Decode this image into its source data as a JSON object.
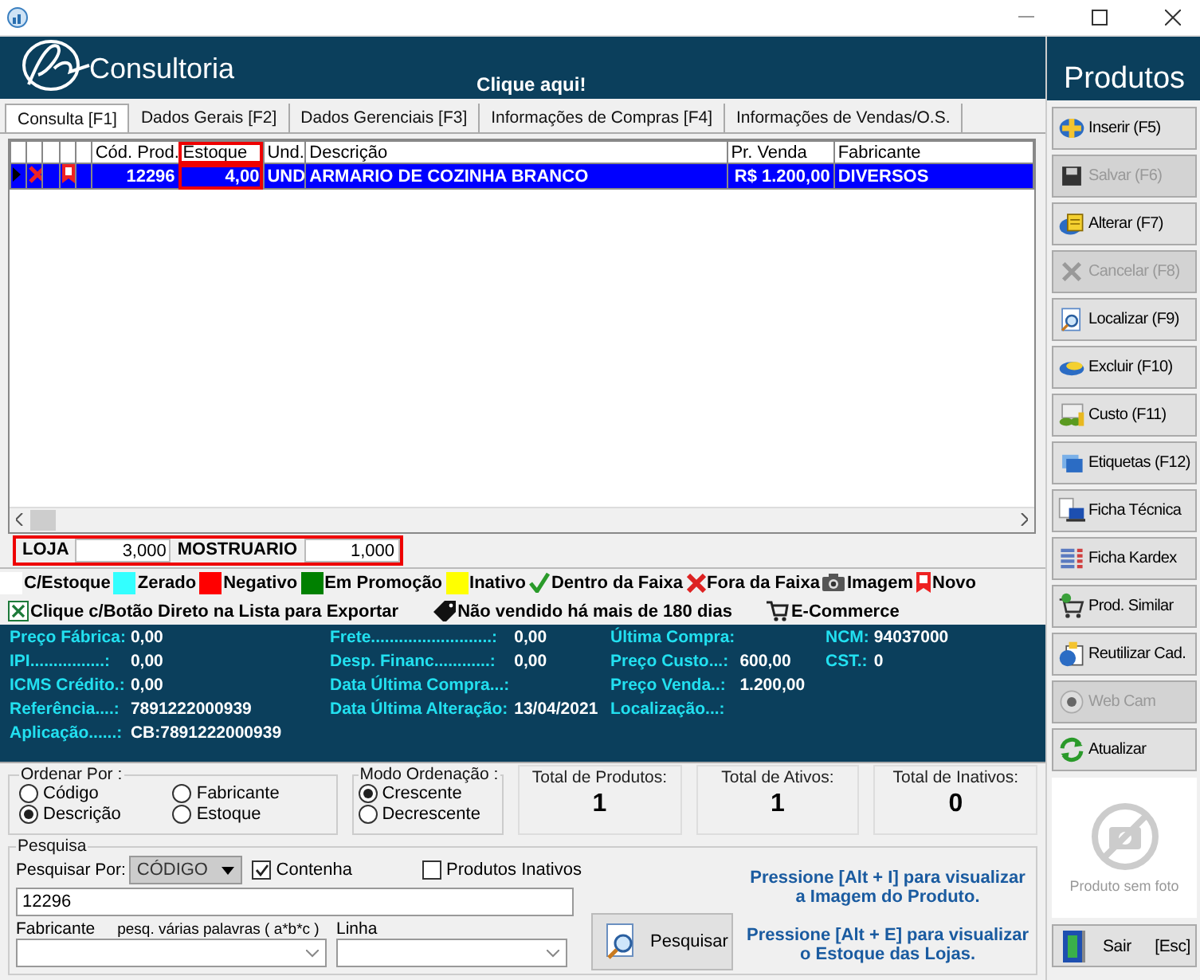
{
  "header": {
    "brand": "Consultoria",
    "banner": "Clique aqui!",
    "title": "Produtos"
  },
  "tabs": [
    {
      "label": "Consulta [F1]",
      "selected": true
    },
    {
      "label": "Dados Gerais [F2]",
      "selected": false
    },
    {
      "label": "Dados Gerenciais [F3]",
      "selected": false
    },
    {
      "label": "Informações de Compras [F4]",
      "selected": false
    },
    {
      "label": "Informações de Vendas/O.S.",
      "selected": false
    }
  ],
  "table": {
    "columns": [
      "Cód. Prod.",
      "Estoque",
      "Und.",
      "Descrição",
      "Pr. Venda",
      "Fabricante"
    ],
    "rows": [
      {
        "selected": true,
        "cells": [
          "12296",
          "4,00",
          "UND",
          "ARMARIO DE COZINHA BRANCO",
          "R$ 1.200,00",
          "DIVERSOS"
        ]
      }
    ]
  },
  "stores": [
    {
      "name": "LOJA",
      "stock": "3,000"
    },
    {
      "name": "MOSTRUARIO",
      "stock": "1,000"
    }
  ],
  "legend": [
    {
      "kind": "swatch",
      "label": "C/Estoque",
      "color": "#ffffff"
    },
    {
      "kind": "swatch",
      "label": "Zerado",
      "color": "#33ffff"
    },
    {
      "kind": "swatch",
      "label": "Negativo",
      "color": "#ff0000"
    },
    {
      "kind": "swatch",
      "label": "Em Promoção",
      "color": "#008000"
    },
    {
      "kind": "swatch",
      "label": "Inativo",
      "color": "#ffff00"
    },
    {
      "kind": "check",
      "label": "Dentro da Faixa"
    },
    {
      "kind": "cross",
      "label": "Fora da Faixa"
    },
    {
      "kind": "camera",
      "label": "Imagem"
    },
    {
      "kind": "ribbon",
      "label": "Novo"
    }
  ],
  "legend_2": [
    {
      "kind": "excel",
      "label": "Clique c/Botão Direto na Lista para Exportar"
    },
    {
      "kind": "tag",
      "label": "Não vendido há mais de 180 dias"
    },
    {
      "kind": "cart",
      "label": "E-Commerce"
    }
  ],
  "info_columns": [
    [
      {
        "label": "Preço Fábrica:",
        "value": "0,00"
      },
      {
        "label": "IPI................:",
        "value": "0,00"
      },
      {
        "label": "ICMS Crédito.:",
        "value": "0,00"
      },
      {
        "label": "Referência....:",
        "value": "7891222000939"
      },
      {
        "label": "Aplicação......:",
        "value": "CB:7891222000939"
      }
    ],
    [
      {
        "label": "Frete..........................:",
        "value": "0,00"
      },
      {
        "label": "Desp. Financ............:",
        "value": "0,00"
      },
      {
        "label": "Data Última Compra...:"
      },
      {
        "label": "Data Última Alteração:",
        "value": "13/04/2021"
      }
    ],
    [
      {
        "label": "Última Compra:"
      },
      {
        "label": "Preço Custo...:",
        "value": "600,00"
      },
      {
        "label": "Preço Venda..:",
        "value": "1.200,00"
      },
      {
        "label": "Localização...:"
      }
    ],
    [
      {
        "label": "NCM:",
        "value": "94037000"
      },
      {
        "label": "CST.:",
        "value": "0"
      }
    ]
  ],
  "sort_by": {
    "title": "Ordenar Por :",
    "options": [
      {
        "label": "Código",
        "selected": false
      },
      {
        "label": "Fabricante",
        "selected": false
      },
      {
        "label": "Descrição",
        "selected": true
      },
      {
        "label": "Estoque",
        "selected": false
      }
    ]
  },
  "sort_mode": {
    "title": "Modo Ordenação :",
    "options": [
      {
        "label": "Crescente",
        "selected": true
      },
      {
        "label": "Decrescente",
        "selected": false
      }
    ]
  },
  "totals": [
    {
      "label": "Total de Produtos:",
      "value": "1"
    },
    {
      "label": "Total de Ativos:",
      "value": "1"
    },
    {
      "label": "Total de Inativos:",
      "value": "0"
    }
  ],
  "search": {
    "title": "Pesquisa",
    "search_by_label": "Pesquisar Por:",
    "search_by": "CÓDIGO",
    "contains": {
      "label": "Contenha",
      "checked": true
    },
    "inactive": {
      "label": "Produtos Inativos",
      "checked": false
    },
    "value": "12296",
    "maker_label": "Fabricante",
    "hint": "pesq. várias palavras ( a*b*c )",
    "line_label": "Linha",
    "button": "Pesquisar",
    "notes": [
      "Pressione [Alt + I] para visualizar a Imagem do Produto.",
      "Pressione [Alt + E] para visualizar o Estoque das Lojas."
    ]
  },
  "actions": [
    {
      "label": "Inserir (F5)",
      "disabled": false
    },
    {
      "label": "Salvar (F6)",
      "disabled": true
    },
    {
      "label": "Alterar (F7)",
      "disabled": false
    },
    {
      "label": "Cancelar (F8)",
      "disabled": true
    },
    {
      "label": "Localizar (F9)",
      "disabled": false
    },
    {
      "label": "Excluir (F10)",
      "disabled": false
    },
    {
      "label": "Custo (F11)",
      "disabled": false
    },
    {
      "label": "Etiquetas (F12)",
      "disabled": false
    },
    {
      "label": "Ficha Técnica",
      "disabled": false
    },
    {
      "label": "Ficha Kardex",
      "disabled": false
    },
    {
      "label": "Prod. Similar",
      "disabled": false
    },
    {
      "label": "Reutilizar Cad.",
      "disabled": false
    },
    {
      "label": "Web Cam",
      "disabled": true
    },
    {
      "label": "Atualizar",
      "disabled": false
    }
  ],
  "photo": {
    "caption": "Produto sem foto"
  },
  "exit_button": {
    "label": "Sair",
    "shortcut": "[Esc]"
  }
}
